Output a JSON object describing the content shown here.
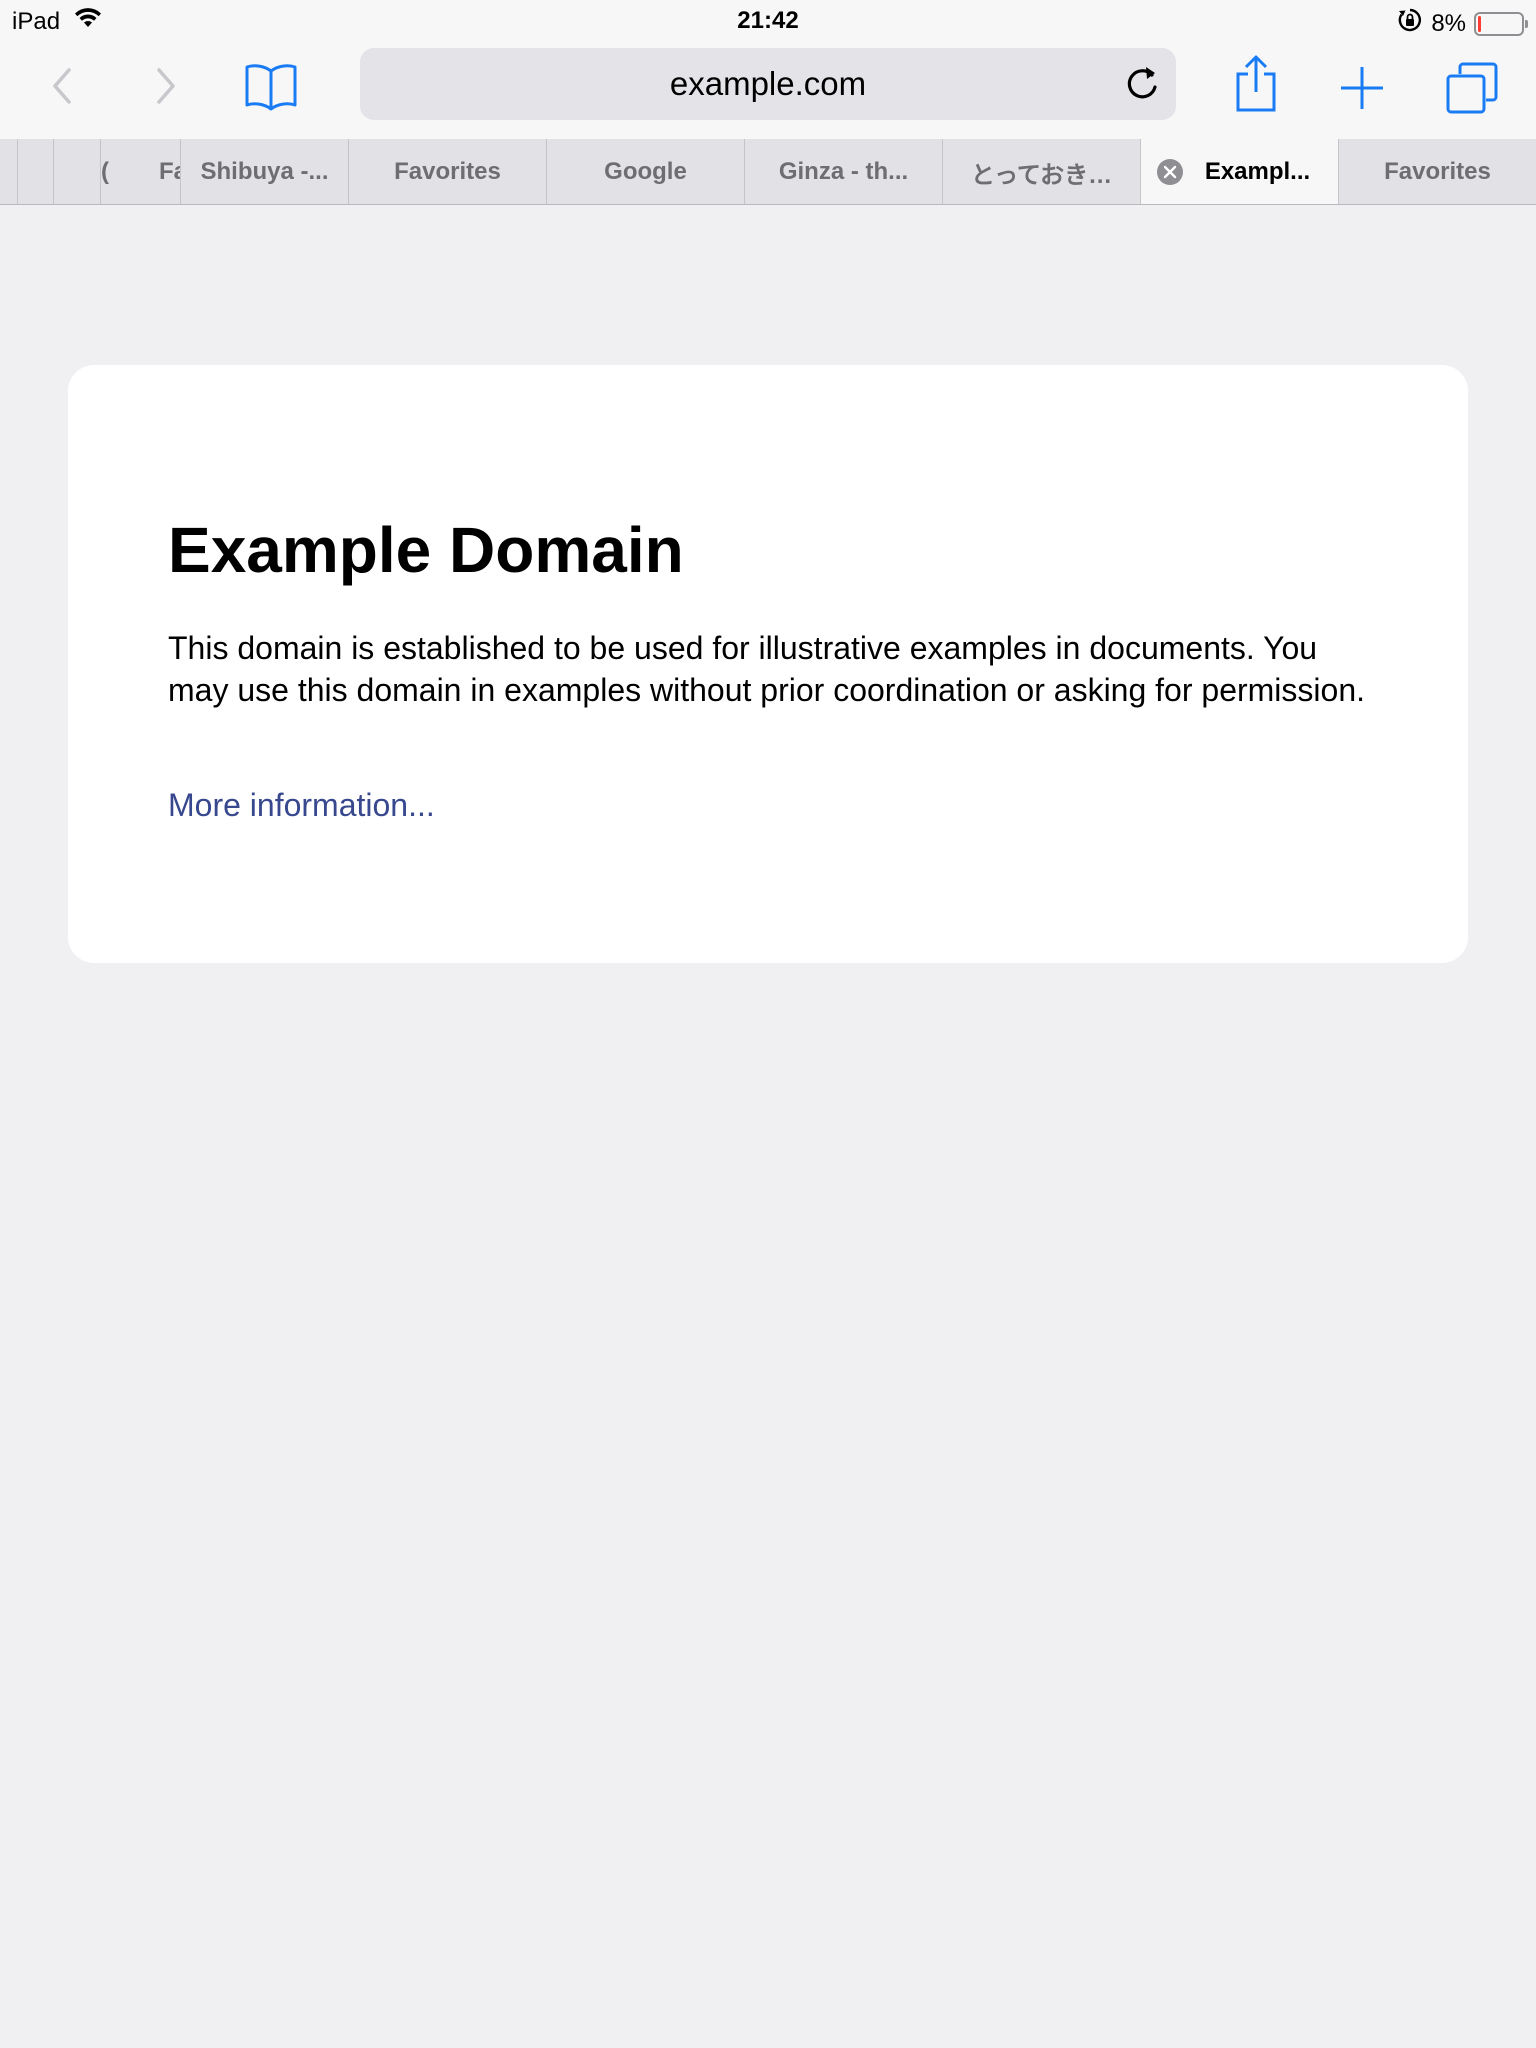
{
  "status_bar": {
    "device": "iPad",
    "time": "21:42",
    "battery_percent_label": "8%",
    "battery_level": 0.08,
    "battery_color": "#ff3b30"
  },
  "toolbar": {
    "back_icon": "chevron-left-icon",
    "forward_icon": "chevron-right-icon",
    "bookmarks_icon": "book-icon",
    "address": "example.com",
    "reload_icon": "reload-icon",
    "share_icon": "share-icon",
    "new_tab_icon": "plus-icon",
    "tabs_icon": "tabs-overview-icon",
    "accent_color": "#1a7cf5"
  },
  "tabs": [
    {
      "label": ""
    },
    {
      "label": ""
    },
    {
      "label": "("
    },
    {
      "label": "Fa"
    },
    {
      "label": "Shibuya -..."
    },
    {
      "label": "Favorites"
    },
    {
      "label": "Google"
    },
    {
      "label": "Ginza - th..."
    },
    {
      "label": "とっておき…"
    },
    {
      "label": "Exampl...",
      "active": true
    },
    {
      "label": "Favorites"
    }
  ],
  "page": {
    "title": "Example Domain",
    "description": "This domain is established to be used for illustrative examples in documents. You may use this domain in examples without prior coordination or asking for permission.",
    "link_text": "More information...",
    "link_color": "#38488f"
  }
}
